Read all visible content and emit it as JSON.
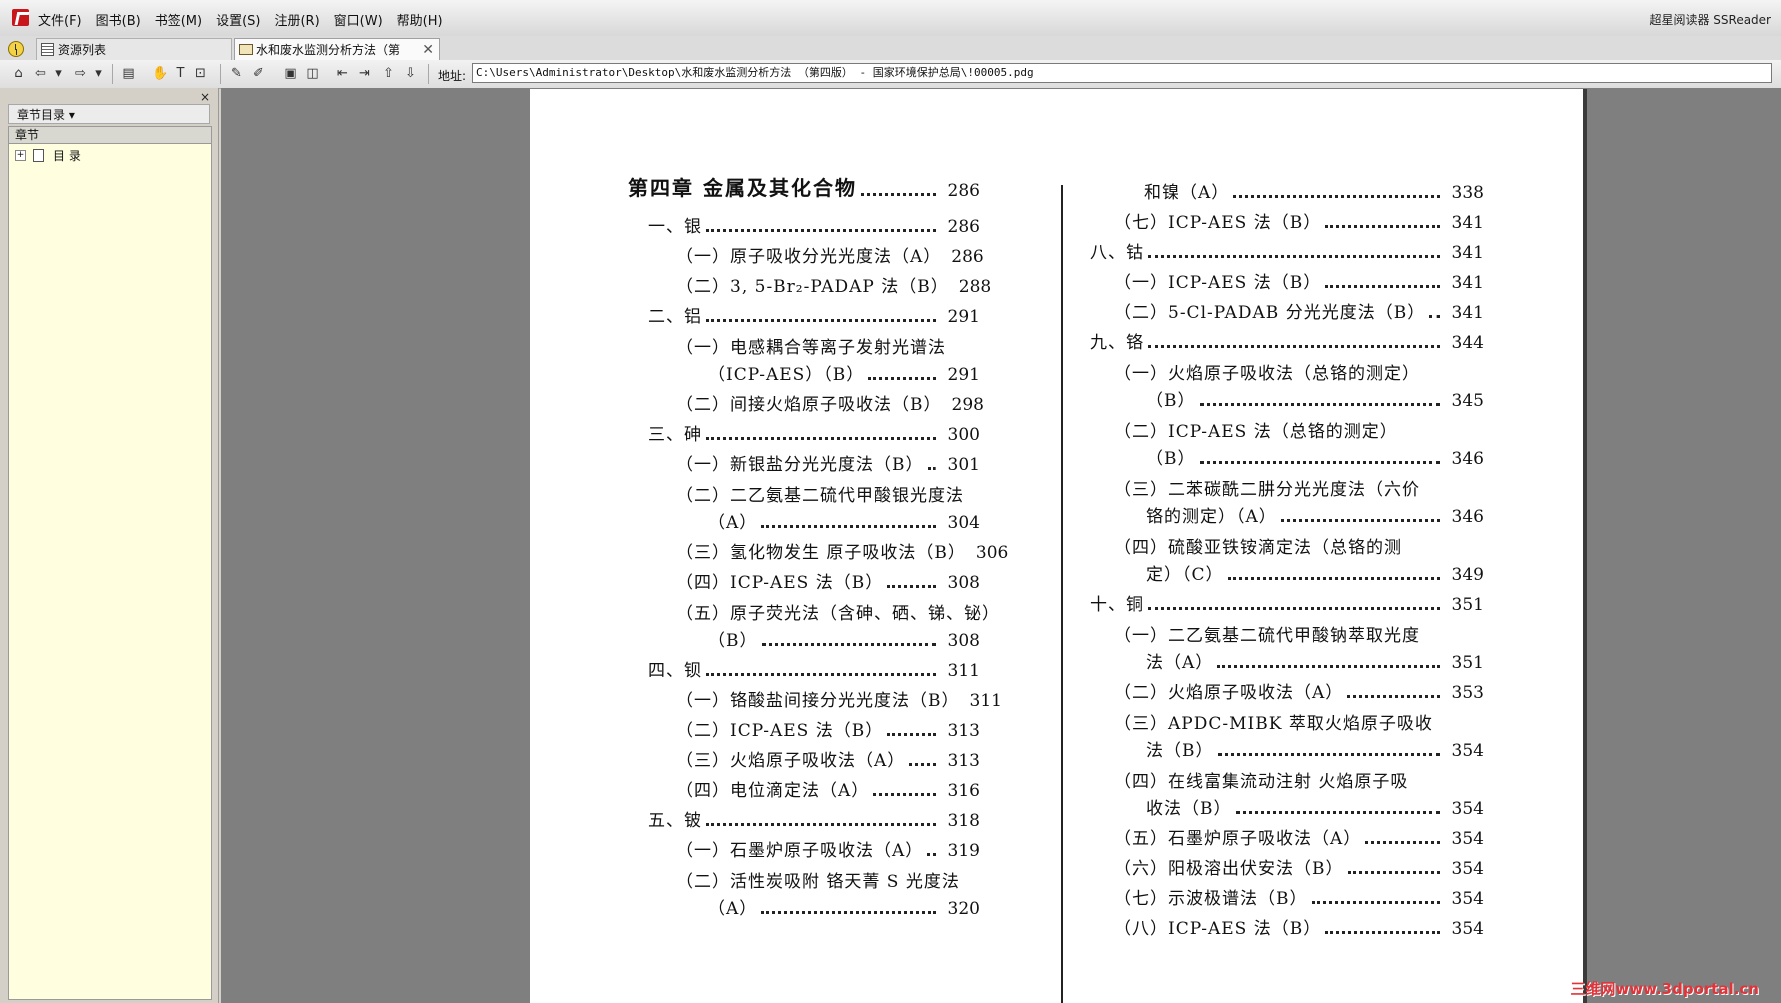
{
  "app": {
    "name": "超星阅读器 SSReader"
  },
  "menu": [
    "文件(F)",
    "图书(B)",
    "书签(M)",
    "设置(S)",
    "注册(R)",
    "窗口(W)",
    "帮助(H)"
  ],
  "tabs": {
    "resource": "资源列表",
    "book": "水和废水监测分析方法（第",
    "close": "✕"
  },
  "toolbar": {
    "address_label": "地址:",
    "address_value": "C:\\Users\\Administrator\\Desktop\\水和废水监测分析方法  （第四版） - 国家环境保护总局\\!00005.pdg"
  },
  "sidebar": {
    "panel_title": "章节目录 ▾",
    "column_header": "章节",
    "root_node": "目 录",
    "close": "×"
  },
  "toc_left": [
    {
      "text": "第四章   金属及其化合物",
      "page": "286",
      "chapter": true
    },
    {
      "text": "一、银",
      "page": "286"
    },
    {
      "text": "（一）原子吸收分光光度法（A）",
      "page": "286"
    },
    {
      "text": "（二）3, 5-Br₂-PADAP 法（B）",
      "page": "288"
    },
    {
      "text": "二、铝",
      "page": "291"
    },
    {
      "text": "（一）电感耦合等离子发射光谱法",
      "cont": "（ICP-AES）（B）",
      "page": "291"
    },
    {
      "text": "（二）间接火焰原子吸收法（B）",
      "page": "298"
    },
    {
      "text": "三、砷",
      "page": "300"
    },
    {
      "text": "（一）新银盐分光光度法（B）",
      "page": "301"
    },
    {
      "text": "（二）二乙氨基二硫代甲酸银光度法",
      "cont": "（A）",
      "page": "304"
    },
    {
      "text": "（三）氢化物发生   原子吸收法（B）",
      "page": "306"
    },
    {
      "text": "（四）ICP-AES 法（B）",
      "page": "308"
    },
    {
      "text": "（五）原子荧光法（含砷、硒、锑、铋）",
      "cont": "（B）",
      "page": "308"
    },
    {
      "text": "四、钡",
      "page": "311"
    },
    {
      "text": "（一）铬酸盐间接分光光度法（B）",
      "page": "311"
    },
    {
      "text": "（二）ICP-AES 法（B）",
      "page": "313"
    },
    {
      "text": "（三）火焰原子吸收法（A）",
      "page": "313"
    },
    {
      "text": "（四）电位滴定法（A）",
      "page": "316"
    },
    {
      "text": "五、铍",
      "page": "318"
    },
    {
      "text": "（一）石墨炉原子吸收法（A）",
      "page": "319"
    },
    {
      "text": "（二）活性炭吸附   铬天菁 S 光度法",
      "cont": "（A）",
      "page": "320"
    }
  ],
  "toc_right": [
    {
      "text": "和镍（A）",
      "page": "338"
    },
    {
      "text": "（七）ICP-AES 法（B）",
      "page": "341"
    },
    {
      "text": "八、钴",
      "page": "341"
    },
    {
      "text": "（一）ICP-AES 法（B）",
      "page": "341"
    },
    {
      "text": "（二）5-Cl-PADAB 分光光度法（B）",
      "page": "341"
    },
    {
      "text": "九、铬",
      "page": "344"
    },
    {
      "text": "（一）火焰原子吸收法（总铬的测定）",
      "cont": "（B）",
      "page": "345"
    },
    {
      "text": "（二）ICP-AES 法（总铬的测定）",
      "cont": "（B）",
      "page": "346"
    },
    {
      "text": "（三）二苯碳酰二肼分光光度法（六价",
      "cont": "铬的测定）（A）",
      "page": "346"
    },
    {
      "text": "（四）硫酸亚铁铵滴定法（总铬的测",
      "cont": "定）（C）",
      "page": "349"
    },
    {
      "text": "十、铜",
      "page": "351"
    },
    {
      "text": "（一）二乙氨基二硫代甲酸钠萃取光度",
      "cont": "法（A）",
      "page": "351"
    },
    {
      "text": "（二）火焰原子吸收法（A）",
      "page": "353"
    },
    {
      "text": "（三）APDC-MIBK 萃取火焰原子吸收",
      "cont": "法（B）",
      "page": "354"
    },
    {
      "text": "（四）在线富集流动注射   火焰原子吸",
      "cont": "收法（B）",
      "page": "354"
    },
    {
      "text": "（五）石墨炉原子吸收法（A）",
      "page": "354"
    },
    {
      "text": "（六）阳极溶出伏安法（B）",
      "page": "354"
    },
    {
      "text": "（七）示波极谱法（B）",
      "page": "354"
    },
    {
      "text": "（八）ICP-AES 法（B）",
      "page": "354"
    }
  ],
  "watermark": "三维网www.3dportal.cn"
}
